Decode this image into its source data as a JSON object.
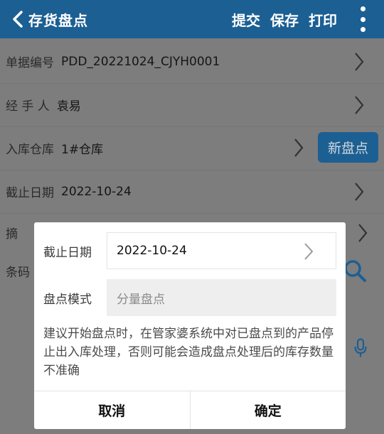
{
  "appbar": {
    "title": "存货盘点",
    "actions": [
      "提交",
      "保存",
      "打印"
    ]
  },
  "form": {
    "doc_no": {
      "label": "单据编号",
      "value": "PDD_20221024_CJYH0001"
    },
    "handler": {
      "label": "经 手 人",
      "value": "袁易"
    },
    "warehouse": {
      "label": "入库仓库",
      "value": "1#仓库"
    },
    "deadline": {
      "label": "截止日期",
      "value": "2022-10-24"
    },
    "summary": {
      "label": "摘"
    },
    "barcode": {
      "label": "条码"
    },
    "new_count_button": "新盘点"
  },
  "dialog": {
    "deadline_label": "截止日期",
    "deadline_value": "2022-10-24",
    "mode_label": "盘点模式",
    "mode_placeholder": "分量盘点",
    "notice": "建议开始盘点时，在管家婆系统中对已盘点到的产品停止出入库处理，否则可能会造成盘点处理后的库存数量不准确",
    "cancel": "取消",
    "confirm": "确定"
  },
  "colors": {
    "appbar": "#1c5f93",
    "overlay_background": "#7d7d7d",
    "dialog_background": "#ffffff"
  },
  "icons": [
    "back-icon",
    "more-icon",
    "chevron-right-icon",
    "search-icon",
    "mic-icon"
  ]
}
